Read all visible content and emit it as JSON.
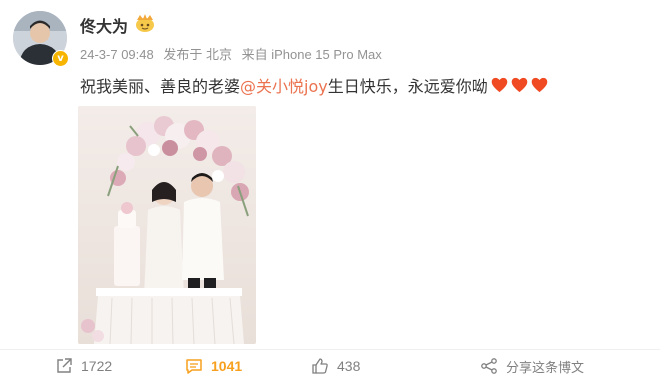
{
  "post": {
    "author": "佟大为",
    "date": "24-3-7 09:48",
    "location": "发布于 北京",
    "device": "来自 iPhone 15 Pro Max",
    "text_before": "祝我美丽、善良的老婆",
    "mention": "@关小悦joy",
    "text_after": " 生日快乐，永远爱你呦"
  },
  "actions": {
    "reposts": "1722",
    "comments": "1041",
    "likes": "438",
    "share": "分享这条博文"
  },
  "colors": {
    "accent": "#eb7350",
    "comment": "#f7a01e",
    "heart": "#f04a22"
  }
}
